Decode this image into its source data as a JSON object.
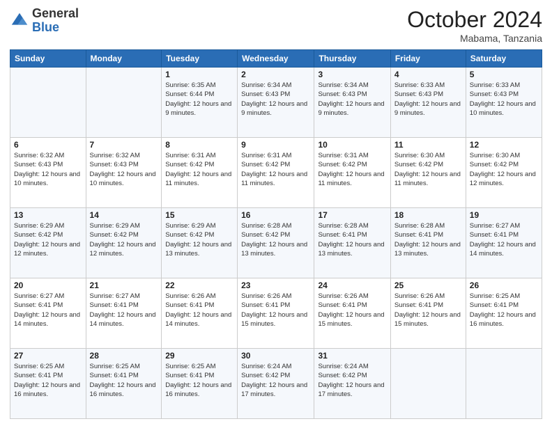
{
  "header": {
    "logo": {
      "general": "General",
      "blue": "Blue"
    },
    "month": "October 2024",
    "location": "Mabama, Tanzania"
  },
  "weekdays": [
    "Sunday",
    "Monday",
    "Tuesday",
    "Wednesday",
    "Thursday",
    "Friday",
    "Saturday"
  ],
  "weeks": [
    [
      {
        "day": "",
        "detail": ""
      },
      {
        "day": "",
        "detail": ""
      },
      {
        "day": "1",
        "detail": "Sunrise: 6:35 AM\nSunset: 6:44 PM\nDaylight: 12 hours and 9 minutes."
      },
      {
        "day": "2",
        "detail": "Sunrise: 6:34 AM\nSunset: 6:43 PM\nDaylight: 12 hours and 9 minutes."
      },
      {
        "day": "3",
        "detail": "Sunrise: 6:34 AM\nSunset: 6:43 PM\nDaylight: 12 hours and 9 minutes."
      },
      {
        "day": "4",
        "detail": "Sunrise: 6:33 AM\nSunset: 6:43 PM\nDaylight: 12 hours and 9 minutes."
      },
      {
        "day": "5",
        "detail": "Sunrise: 6:33 AM\nSunset: 6:43 PM\nDaylight: 12 hours and 10 minutes."
      }
    ],
    [
      {
        "day": "6",
        "detail": "Sunrise: 6:32 AM\nSunset: 6:43 PM\nDaylight: 12 hours and 10 minutes."
      },
      {
        "day": "7",
        "detail": "Sunrise: 6:32 AM\nSunset: 6:43 PM\nDaylight: 12 hours and 10 minutes."
      },
      {
        "day": "8",
        "detail": "Sunrise: 6:31 AM\nSunset: 6:42 PM\nDaylight: 12 hours and 11 minutes."
      },
      {
        "day": "9",
        "detail": "Sunrise: 6:31 AM\nSunset: 6:42 PM\nDaylight: 12 hours and 11 minutes."
      },
      {
        "day": "10",
        "detail": "Sunrise: 6:31 AM\nSunset: 6:42 PM\nDaylight: 12 hours and 11 minutes."
      },
      {
        "day": "11",
        "detail": "Sunrise: 6:30 AM\nSunset: 6:42 PM\nDaylight: 12 hours and 11 minutes."
      },
      {
        "day": "12",
        "detail": "Sunrise: 6:30 AM\nSunset: 6:42 PM\nDaylight: 12 hours and 12 minutes."
      }
    ],
    [
      {
        "day": "13",
        "detail": "Sunrise: 6:29 AM\nSunset: 6:42 PM\nDaylight: 12 hours and 12 minutes."
      },
      {
        "day": "14",
        "detail": "Sunrise: 6:29 AM\nSunset: 6:42 PM\nDaylight: 12 hours and 12 minutes."
      },
      {
        "day": "15",
        "detail": "Sunrise: 6:29 AM\nSunset: 6:42 PM\nDaylight: 12 hours and 13 minutes."
      },
      {
        "day": "16",
        "detail": "Sunrise: 6:28 AM\nSunset: 6:42 PM\nDaylight: 12 hours and 13 minutes."
      },
      {
        "day": "17",
        "detail": "Sunrise: 6:28 AM\nSunset: 6:41 PM\nDaylight: 12 hours and 13 minutes."
      },
      {
        "day": "18",
        "detail": "Sunrise: 6:28 AM\nSunset: 6:41 PM\nDaylight: 12 hours and 13 minutes."
      },
      {
        "day": "19",
        "detail": "Sunrise: 6:27 AM\nSunset: 6:41 PM\nDaylight: 12 hours and 14 minutes."
      }
    ],
    [
      {
        "day": "20",
        "detail": "Sunrise: 6:27 AM\nSunset: 6:41 PM\nDaylight: 12 hours and 14 minutes."
      },
      {
        "day": "21",
        "detail": "Sunrise: 6:27 AM\nSunset: 6:41 PM\nDaylight: 12 hours and 14 minutes."
      },
      {
        "day": "22",
        "detail": "Sunrise: 6:26 AM\nSunset: 6:41 PM\nDaylight: 12 hours and 14 minutes."
      },
      {
        "day": "23",
        "detail": "Sunrise: 6:26 AM\nSunset: 6:41 PM\nDaylight: 12 hours and 15 minutes."
      },
      {
        "day": "24",
        "detail": "Sunrise: 6:26 AM\nSunset: 6:41 PM\nDaylight: 12 hours and 15 minutes."
      },
      {
        "day": "25",
        "detail": "Sunrise: 6:26 AM\nSunset: 6:41 PM\nDaylight: 12 hours and 15 minutes."
      },
      {
        "day": "26",
        "detail": "Sunrise: 6:25 AM\nSunset: 6:41 PM\nDaylight: 12 hours and 16 minutes."
      }
    ],
    [
      {
        "day": "27",
        "detail": "Sunrise: 6:25 AM\nSunset: 6:41 PM\nDaylight: 12 hours and 16 minutes."
      },
      {
        "day": "28",
        "detail": "Sunrise: 6:25 AM\nSunset: 6:41 PM\nDaylight: 12 hours and 16 minutes."
      },
      {
        "day": "29",
        "detail": "Sunrise: 6:25 AM\nSunset: 6:41 PM\nDaylight: 12 hours and 16 minutes."
      },
      {
        "day": "30",
        "detail": "Sunrise: 6:24 AM\nSunset: 6:42 PM\nDaylight: 12 hours and 17 minutes."
      },
      {
        "day": "31",
        "detail": "Sunrise: 6:24 AM\nSunset: 6:42 PM\nDaylight: 12 hours and 17 minutes."
      },
      {
        "day": "",
        "detail": ""
      },
      {
        "day": "",
        "detail": ""
      }
    ]
  ]
}
